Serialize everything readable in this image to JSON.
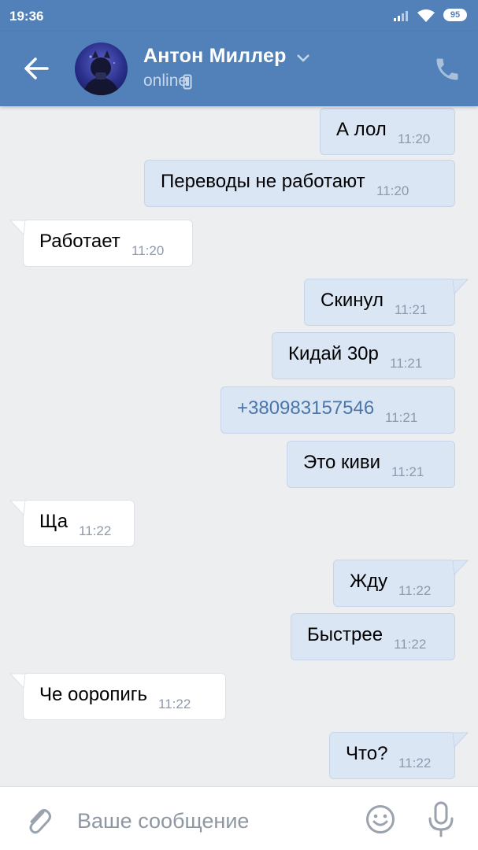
{
  "status_bar": {
    "time": "19:36",
    "battery": "95"
  },
  "header": {
    "contact_name": "Антон Миллер",
    "contact_status": "online",
    "icons": [
      "arrow-left-icon",
      "chevron-down-icon",
      "mobile-phone-icon",
      "phone-icon"
    ]
  },
  "messages": [
    {
      "side": "out",
      "text": "А лол",
      "time": "11:20"
    },
    {
      "side": "out",
      "text": "Переводы не работают",
      "time": "11:20"
    },
    {
      "side": "in",
      "text": "Работает",
      "time": "11:20"
    },
    {
      "side": "out",
      "text": "Скинул",
      "time": "11:21"
    },
    {
      "side": "out",
      "text": "Кидай 30р",
      "time": "11:21"
    },
    {
      "side": "out",
      "text": "+380983157546",
      "time": "11:21",
      "is_link": true
    },
    {
      "side": "out",
      "text": "Это киви",
      "time": "11:21"
    },
    {
      "side": "in",
      "text": "Ща",
      "time": "11:22"
    },
    {
      "side": "out",
      "text": "Жду",
      "time": "11:22"
    },
    {
      "side": "out",
      "text": "Быстрее",
      "time": "11:22"
    },
    {
      "side": "in",
      "text": "Че ооропигь",
      "time": "11:22"
    },
    {
      "side": "out",
      "text": "Что?",
      "time": "11:22"
    }
  ],
  "composer": {
    "placeholder": "Ваше сообщение",
    "icons": [
      "paperclip-icon",
      "smiley-icon",
      "microphone-icon"
    ]
  },
  "colors": {
    "header_bg": "#5181b8",
    "outgoing_bubble": "#dbe6f5",
    "incoming_bubble": "#ffffff",
    "chat_bg": "#edeef0",
    "link": "#4a76a8",
    "timestamp": "#8c9aab"
  }
}
